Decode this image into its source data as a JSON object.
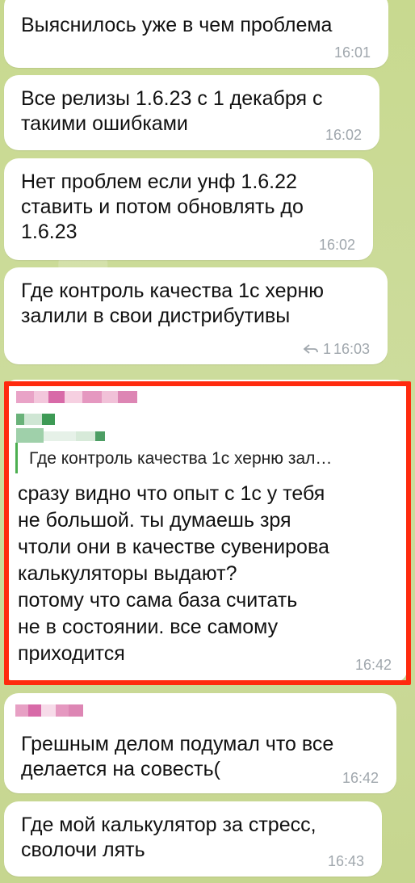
{
  "messages": [
    {
      "text": "Выяснилось уже в чем проблема",
      "time": "16:01"
    },
    {
      "text": "Все релизы 1.6.23 с 1 декабря с\nтакими ошибками",
      "time": "16:02"
    },
    {
      "text": "Нет проблем если унф 1.6.22\nставить и потом обновлять до\n1.6.23",
      "time": "16:02"
    },
    {
      "text": "Где контроль качества 1с херню\nзалили в свои дистрибутивы",
      "time": "16:03",
      "reply_count": "1"
    },
    {
      "reply_preview": "Где контроль качества 1с херню зал…",
      "text": "сразу видно что опыт с 1с у тебя\nне большой. ты думаешь зря\nчтоли они в качестве сувенирова\nкалькуляторы выдают?\nпотому что сама база считать\nне в состоянии. все самому\nприходится",
      "time": "16:42"
    },
    {
      "text": "Грешным делом подумал что все\nделается на совесть(",
      "time": "16:42"
    },
    {
      "text": "Где мой калькулятор за стресс,\nсволочи лять",
      "time": "16:43"
    }
  ],
  "colors": {
    "highlight": "#ff2a0e",
    "reply_bar": "#4caf50",
    "background": "#c9d99a"
  },
  "icons": {
    "reply": "reply-arrow-icon"
  }
}
